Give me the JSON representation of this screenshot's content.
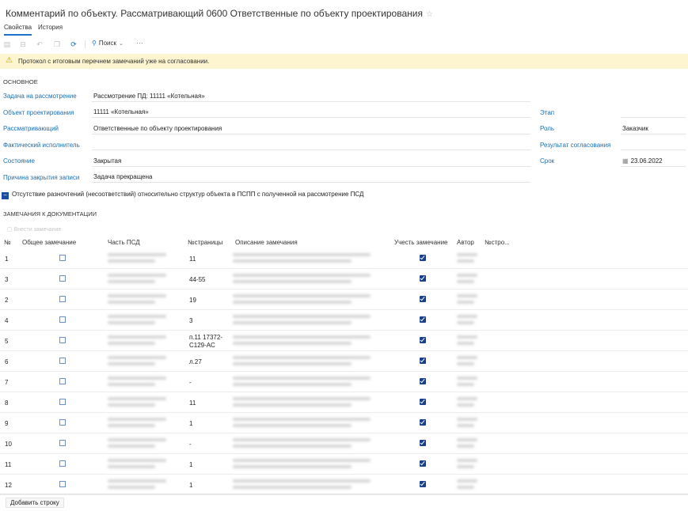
{
  "title": "Комментарий по объекту. Рассматривающий 0600 Ответственные по объекту проектирования",
  "tabs": [
    {
      "label": "Свойства",
      "active": true
    },
    {
      "label": "История",
      "active": false
    }
  ],
  "toolbar": {
    "search_label": "Поиск",
    "more_label": "···"
  },
  "warning": "Протокол с итоговым перечнем замечаний уже на согласовании.",
  "section_main": "ОСНОВНОЕ",
  "fields": {
    "task": {
      "label": "Задача на рассмотрение",
      "value": "Рассмотрение ПД: 11111 «Котельная»"
    },
    "object": {
      "label": "Объект проектирования",
      "value": "11111 «Котельная»"
    },
    "reviewer": {
      "label": "Рассматривающий",
      "value": "Ответственные по объекту проектирования"
    },
    "executor": {
      "label": "Фактический исполнитель",
      "value": ""
    },
    "state": {
      "label": "Состояние",
      "value": "Закрытая"
    },
    "close_reason": {
      "label": "Причина закрытия записи",
      "value": "Задача прекращена"
    },
    "stage": {
      "label": "Этап",
      "value": ""
    },
    "role": {
      "label": "Роль",
      "value": "Заказчик"
    },
    "approval": {
      "label": "Результат согласования",
      "value": ""
    },
    "deadline": {
      "label": "Срок",
      "value": "23.06.2022"
    }
  },
  "checkbox_line": "Отсутствие разночтений (несоответствий) относительно структур объекта в ПСПП с полученной на рассмотрение ПСД",
  "section_remarks": "ЗАМЕЧАНИЯ К ДОКУМЕНТАЦИИ",
  "add_remark_label": "Внести замечание",
  "table": {
    "headers": [
      "№",
      "Общее замечание",
      "Часть ПСД",
      "№страницы",
      "Описание замечания",
      "Учесть замечание",
      "Автор",
      "№стро..."
    ],
    "rows": [
      {
        "num": "1",
        "general": false,
        "page": "11",
        "page2": "",
        "account": true
      },
      {
        "num": "3",
        "general": false,
        "page": "44-55",
        "page2": "",
        "account": true
      },
      {
        "num": "2",
        "general": false,
        "page": "19",
        "page2": "",
        "account": true
      },
      {
        "num": "4",
        "general": false,
        "page": "3",
        "page2": "",
        "account": true
      },
      {
        "num": "5",
        "general": false,
        "page": "п.11 17372-",
        "page2": "C129-АС",
        "account": true
      },
      {
        "num": "6",
        "general": false,
        "page": "л.27",
        "page2": "",
        "account": true
      },
      {
        "num": "7",
        "general": false,
        "page": "-",
        "page2": "",
        "account": true
      },
      {
        "num": "8",
        "general": false,
        "page": "11",
        "page2": "",
        "account": true
      },
      {
        "num": "9",
        "general": false,
        "page": "1",
        "page2": "",
        "account": true
      },
      {
        "num": "10",
        "general": false,
        "page": "-",
        "page2": "",
        "account": true
      },
      {
        "num": "11",
        "general": false,
        "page": "1",
        "page2": "",
        "account": true
      },
      {
        "num": "12",
        "general": false,
        "page": "1",
        "page2": "",
        "account": true
      }
    ]
  },
  "footer": {
    "add_row_label": "Добавить строку"
  }
}
